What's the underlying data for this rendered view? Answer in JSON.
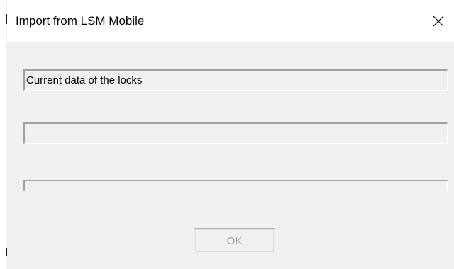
{
  "window": {
    "title": "Import from LSM Mobile",
    "close_icon": "close-icon"
  },
  "dialog": {
    "status_text": "Current data of the locks",
    "secondary_text": "",
    "progress_fraction": 0,
    "ok_label": "OK",
    "ok_enabled": false
  },
  "colors": {
    "titlebar_background": "#ffffff",
    "dialog_background": "#f0f0f0",
    "disabled_text": "#a0a0a0",
    "progress_fill": "#06b025"
  }
}
